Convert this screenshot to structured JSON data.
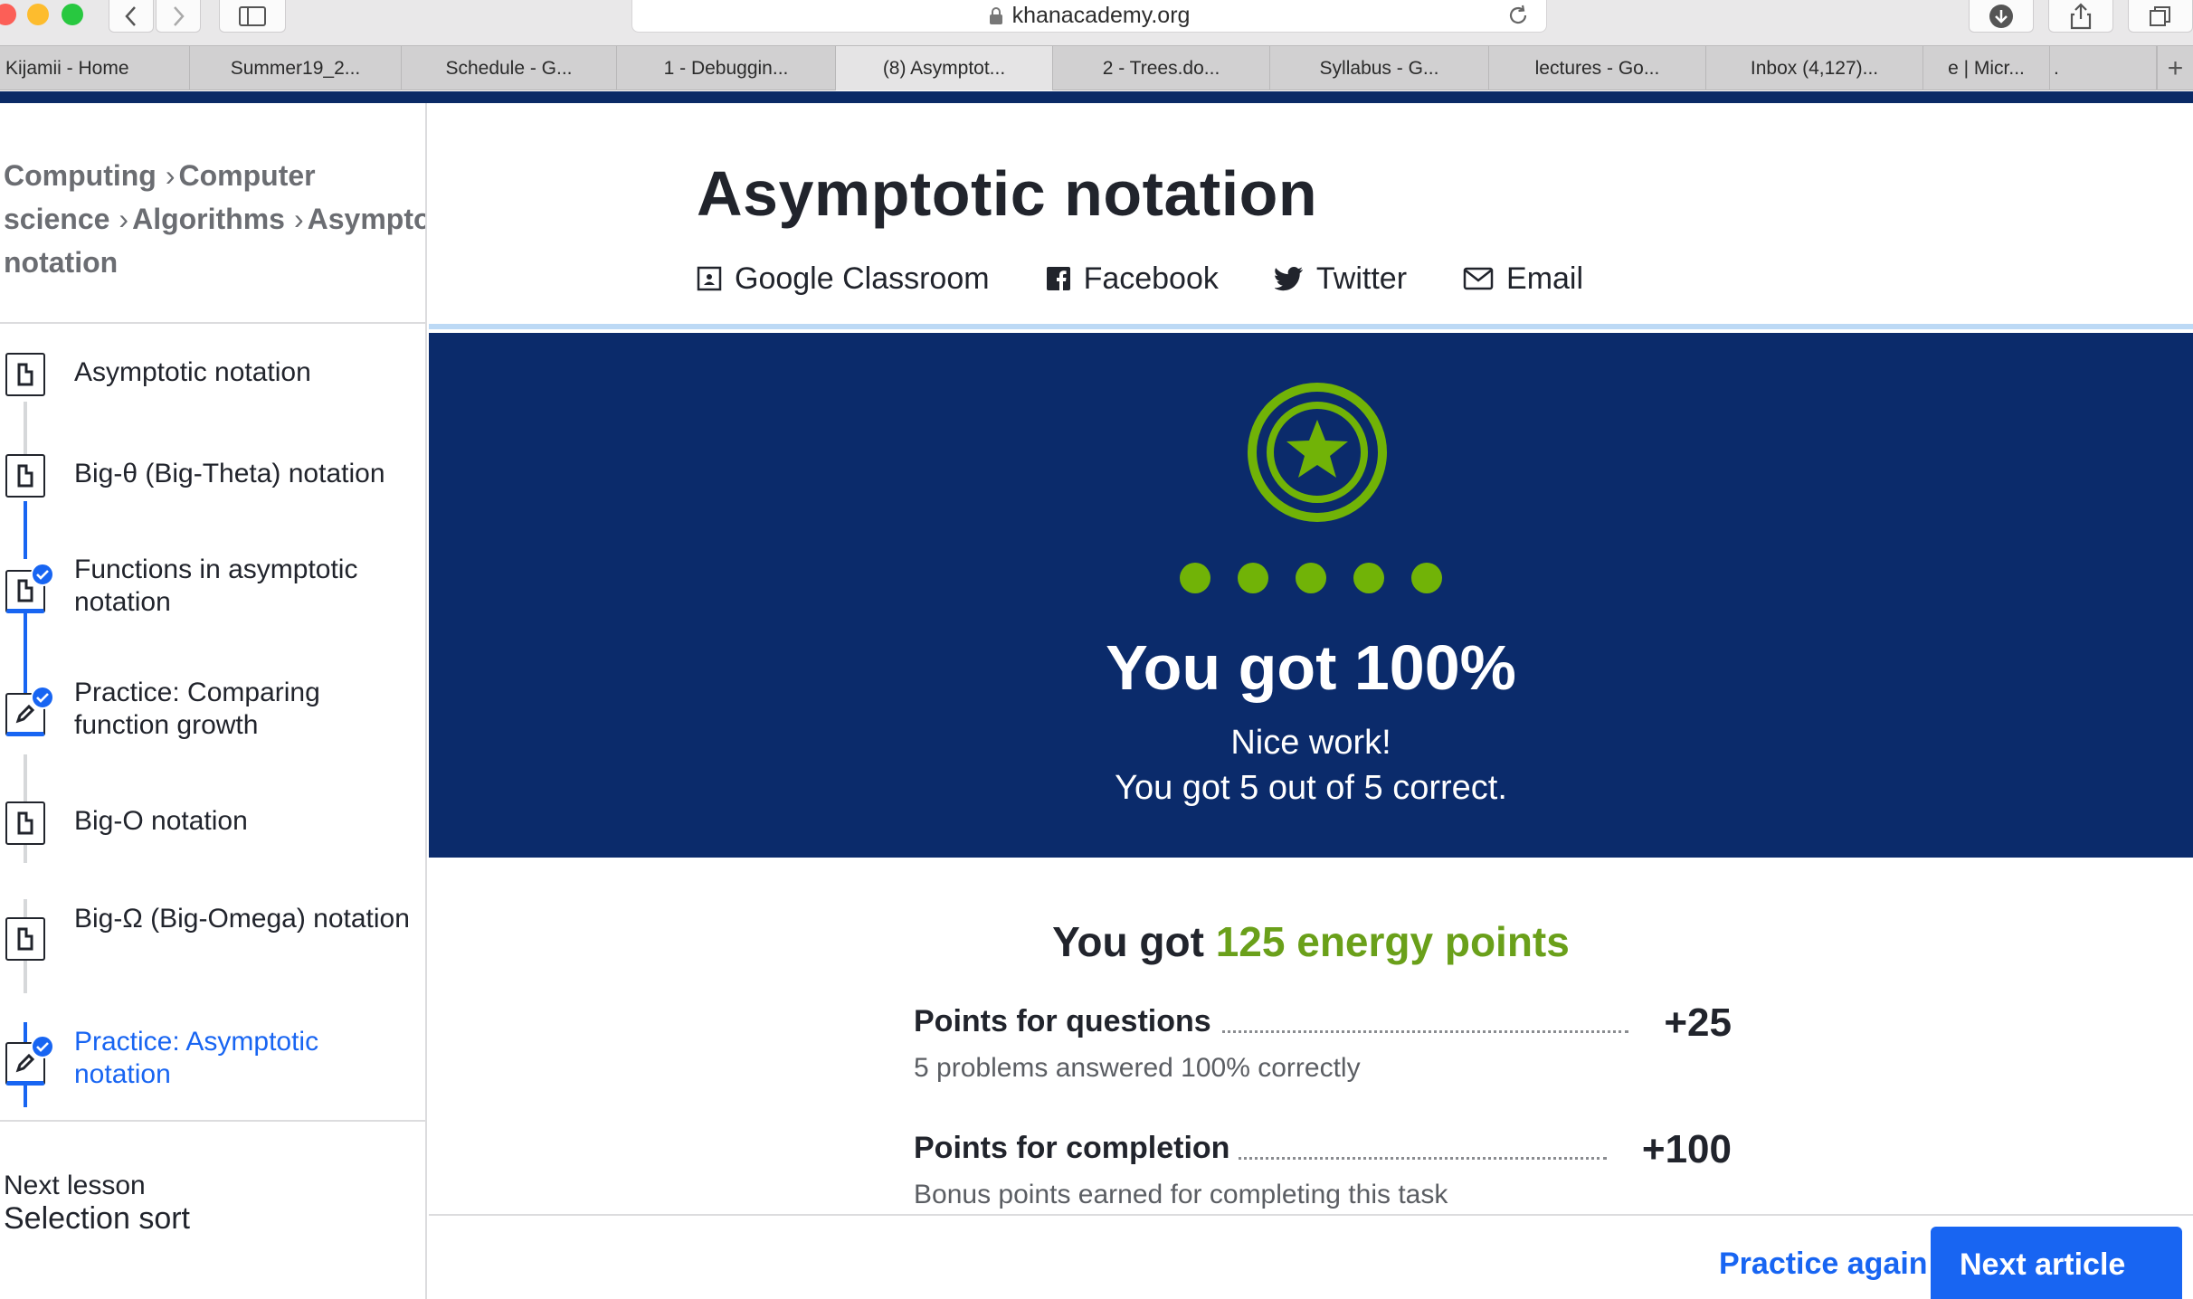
{
  "browser": {
    "url": "khanacademy.org",
    "tabs": [
      "Kijamii - Home",
      "Summer19_2...",
      "Schedule - G...",
      "1 - Debuggin...",
      "(8) Asymptot...",
      "2 - Trees.do...",
      "Syllabus - G...",
      "lectures - Go...",
      "Inbox (4,127)...",
      "e | Micr...",
      "."
    ],
    "active_tab_index": 4,
    "new_tab_label": "+"
  },
  "sidebar": {
    "breadcrumb": [
      "Computing",
      "Computer science",
      "Algorithms",
      "Asymptotic notation"
    ],
    "breadcrumb_line1_a": "Computing",
    "breadcrumb_line1_b": "Computer",
    "breadcrumb_line2_a": "science",
    "breadcrumb_line2_b": "Algorithms",
    "breadcrumb_line2_c": "Asymptoti",
    "breadcrumb_line3": "notation",
    "lessons": [
      {
        "title": "Asymptotic notation",
        "type": "article",
        "completed": false
      },
      {
        "title": "Big-θ (Big-Theta) notation",
        "type": "article",
        "completed": false
      },
      {
        "title": "Functions in asymptotic notation",
        "type": "article",
        "completed": true
      },
      {
        "title": "Practice: Comparing function growth",
        "type": "exercise",
        "completed": true
      },
      {
        "title": "Big-O notation",
        "type": "article",
        "completed": false
      },
      {
        "title": "Big-Ω (Big-Omega) notation",
        "type": "article",
        "completed": false
      },
      {
        "title": "Practice: Asymptotic notation",
        "type": "exercise",
        "completed": true,
        "current": true
      }
    ],
    "next_lesson_label": "Next lesson",
    "next_lesson_title": "Selection sort"
  },
  "main": {
    "title": "Asymptotic notation",
    "share": {
      "google_classroom": "Google Classroom",
      "facebook": "Facebook",
      "twitter": "Twitter",
      "email": "Email"
    },
    "result": {
      "score_text": "You got 100%",
      "nice": "Nice work!",
      "summary": "You got 5 out of 5 correct.",
      "correct": 5,
      "total": 5
    },
    "energy": {
      "prefix": "You got ",
      "points_text": "125 energy points",
      "questions_label": "Points for questions",
      "questions_value": "+25",
      "questions_sub": "5 problems answered 100% correctly",
      "completion_label": "Points for completion",
      "completion_value": "+100",
      "completion_sub": "Bonus points earned for completing this task"
    },
    "actions": {
      "practice_again": "Practice again",
      "next_article": "Next article"
    }
  },
  "colors": {
    "banner": "#0b2b6b",
    "accent_green": "#71b307",
    "link_blue": "#1865f2",
    "header_navy": "#0a2a66"
  }
}
